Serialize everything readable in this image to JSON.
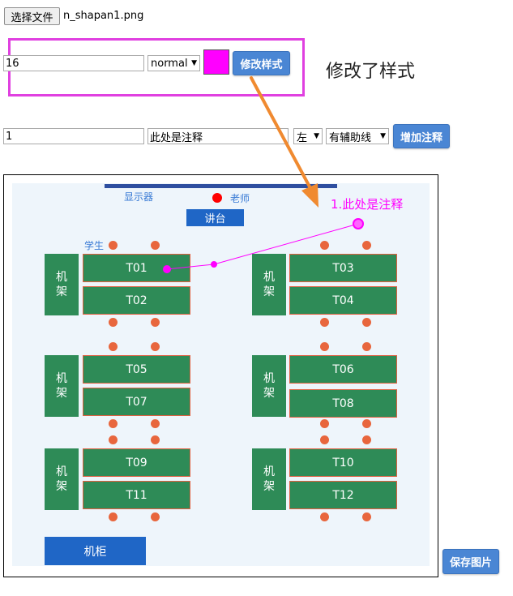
{
  "file": {
    "choose_label": "选择文件",
    "file_name": "n_shapan1.png"
  },
  "style_row": {
    "font_size": "16",
    "font_weight": "normal",
    "color": "#ff00ff",
    "apply_label": "修改样式",
    "status": "修改了样式"
  },
  "annotation_row": {
    "index": "1",
    "text": "此处是注释",
    "side": "左",
    "guide": "有辅助线",
    "add_label": "增加注释"
  },
  "canvas": {
    "display_label": "显示器",
    "teacher_label": "老师",
    "podium_label": "讲台",
    "student_label": "学生",
    "rack_label": [
      "机",
      "架"
    ],
    "cabinet_label": "机柜",
    "desks": [
      "T01",
      "T02",
      "T03",
      "T04",
      "T05",
      "T06",
      "T07",
      "T08",
      "T09",
      "T10",
      "T11",
      "T12"
    ],
    "annotation": "1.此处是注释",
    "colors": {
      "bg": "#eef5fb",
      "green": "#2e8b57",
      "seat": "#e8663d",
      "blue": "#1f66c6",
      "annotation": "#ff00ff",
      "teacher_dot": "#ff0000"
    }
  },
  "save_label": "保存图片",
  "accent": {
    "highlight_box": "#e040e0",
    "arrow": "#f08a30"
  }
}
